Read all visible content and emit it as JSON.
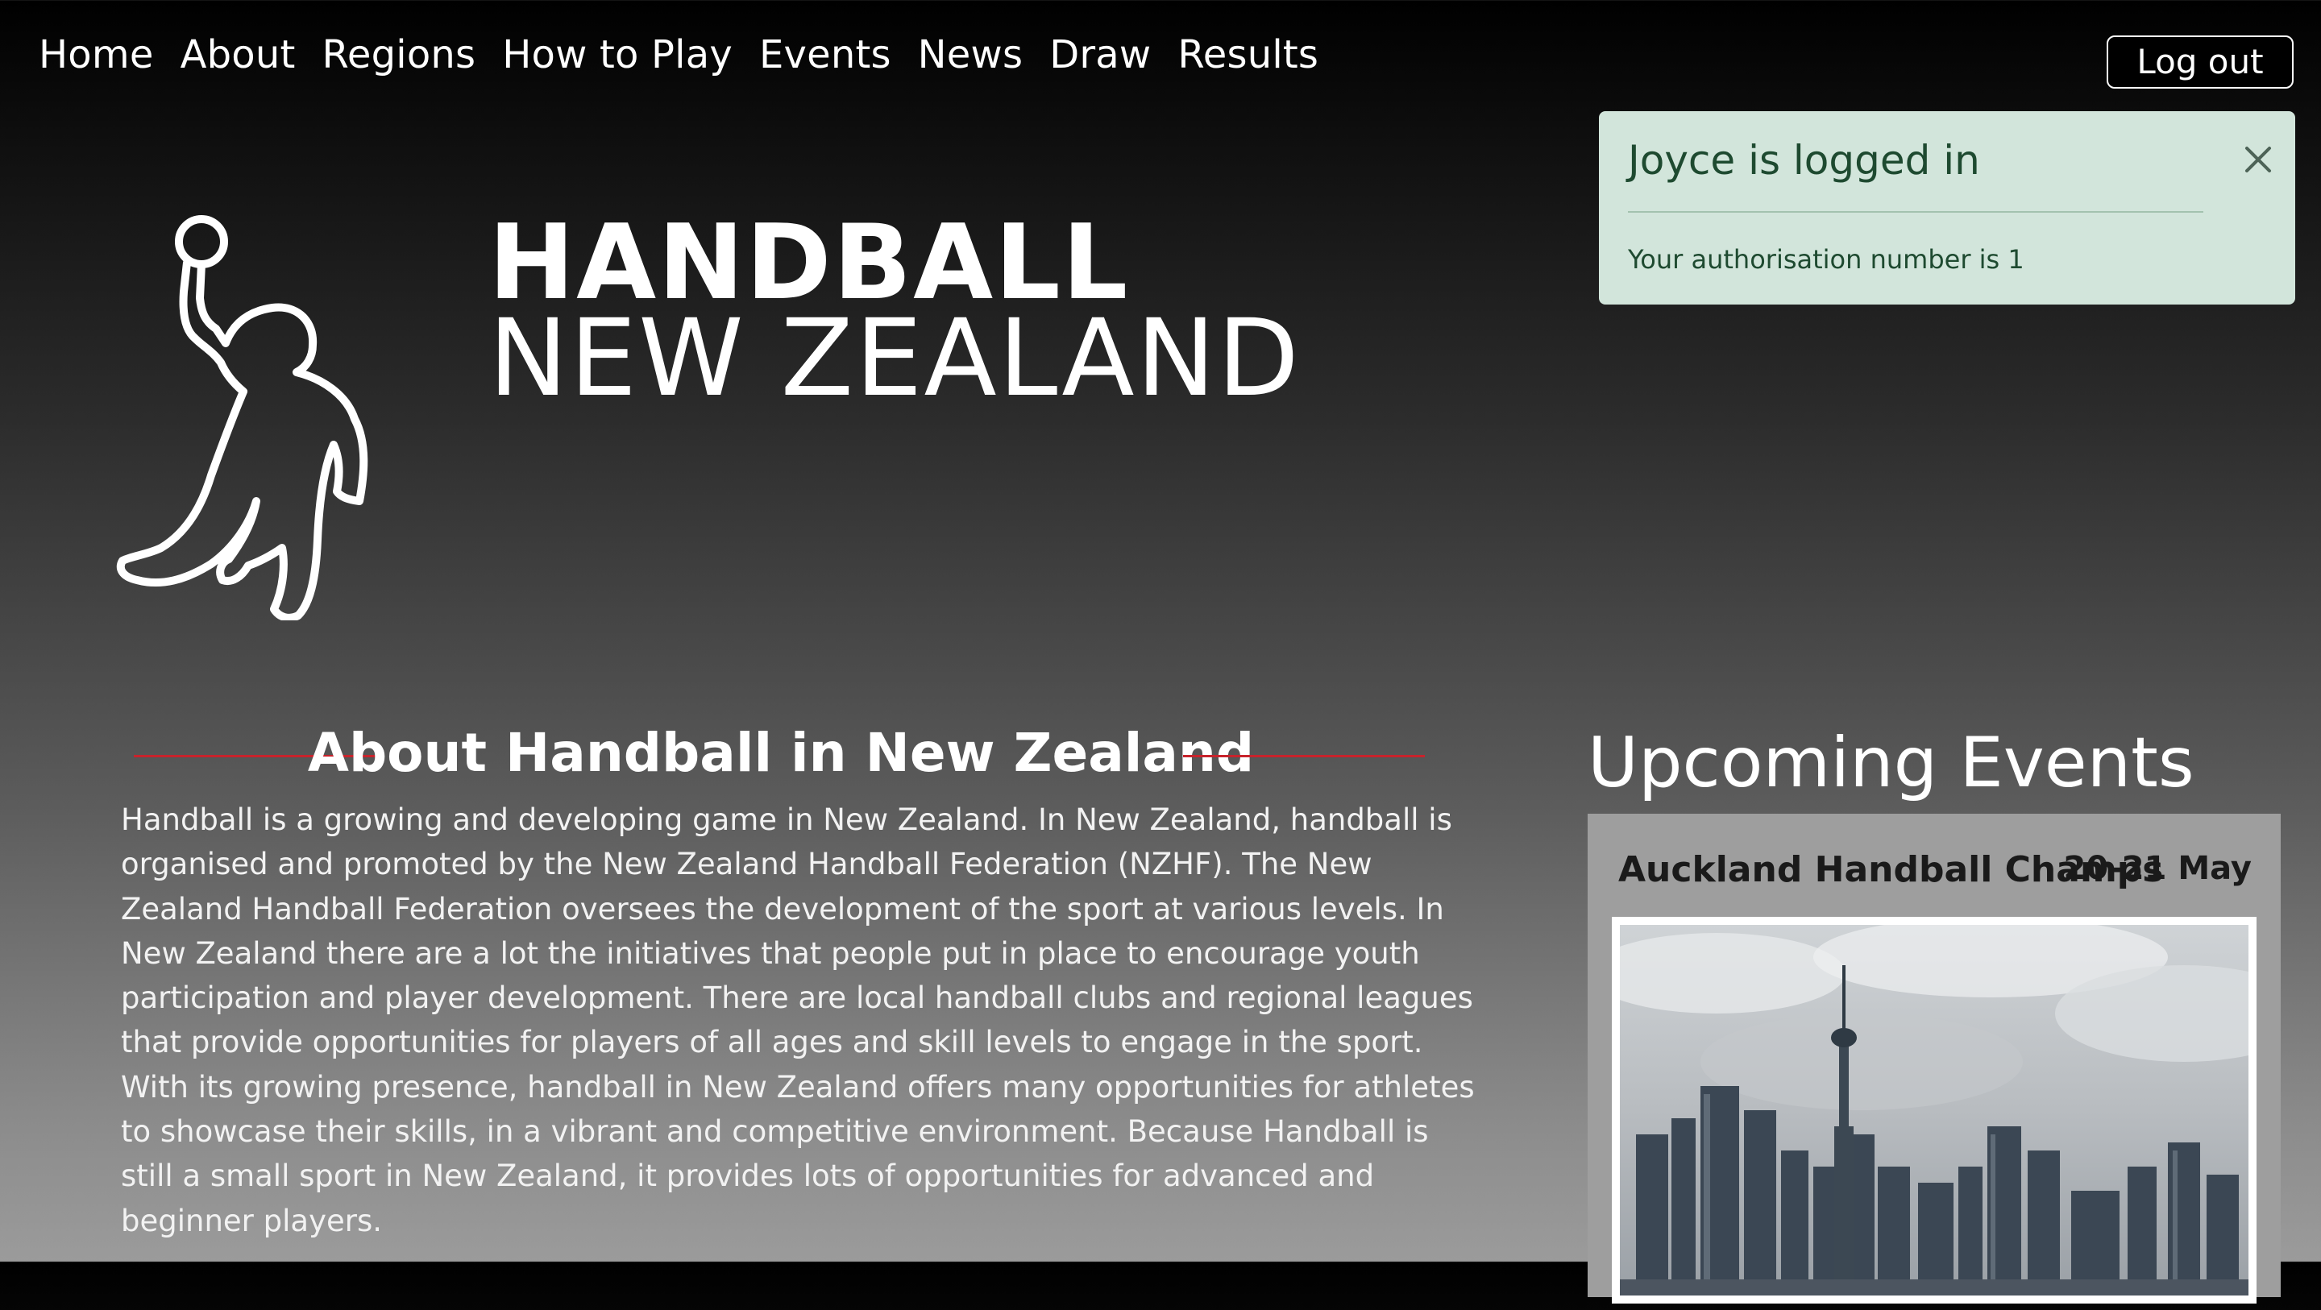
{
  "nav": {
    "items": [
      "Home",
      "About",
      "Regions",
      "How to Play",
      "Events",
      "News",
      "Draw",
      "Results"
    ],
    "logout_label": "Log out"
  },
  "alert": {
    "heading": "Joyce is logged in",
    "message": "Your authorisation number is 1",
    "close_icon": "close-icon"
  },
  "brand": {
    "line1": "HANDBALL",
    "line2": "NEW ZEALAND",
    "logo_icon": "handball-player-outline-icon"
  },
  "about": {
    "title": "About Handball in New Zealand",
    "text": "Handball is a growing and developing game in New Zealand. In New Zealand, handball is organised and promoted by the New Zealand Handball Federation (NZHF). The New Zealand Handball Federation oversees the development of the sport at various levels. In New Zealand there are a lot the initiatives that people put in place to encourage youth participation and player development. There are local handball clubs and regional leagues that provide opportunities for players of all ages and skill levels to engage in the sport. With its growing presence, handball in New Zealand offers many opportunities for athletes to showcase their skills, in a vibrant and competitive environment. Because Handball is still a small sport in New Zealand, it provides lots of opportunities for advanced and beginner players."
  },
  "upcoming": {
    "title": "Upcoming Events",
    "events": [
      {
        "name": "Auckland Handball Champs",
        "date": "20-21 May",
        "image": "auckland-skyline-photo"
      }
    ]
  },
  "colors": {
    "accent_red": "#c8232c",
    "alert_bg": "#d2e5db",
    "alert_text": "#1e4a30",
    "card_bg": "#9e9e9e"
  }
}
